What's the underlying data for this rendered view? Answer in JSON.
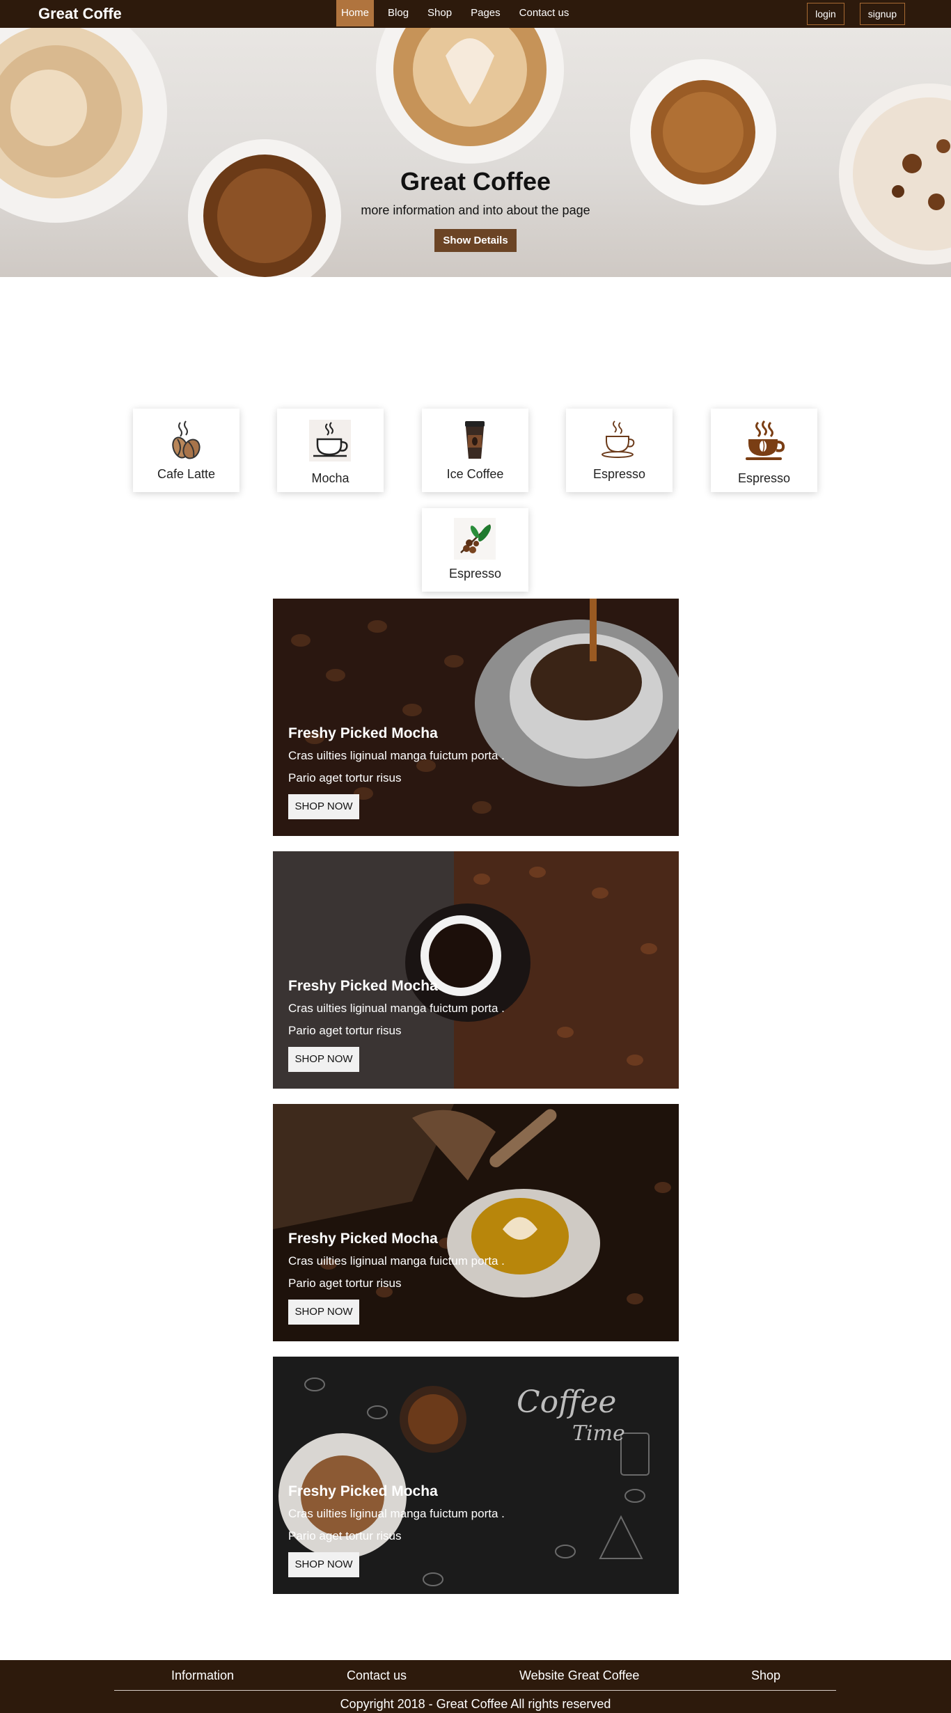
{
  "navbar": {
    "brand": "Great Coffe",
    "links": [
      "Home",
      "Blog",
      "Shop",
      "Pages",
      "Contact us"
    ],
    "active_link": "Home",
    "login": "login",
    "signup": "signup",
    "bg_color": "#2d1a0c",
    "accent_color": "#b0743e"
  },
  "hero": {
    "title": "Great Coffee",
    "subtitle": "more information and into about the page",
    "button": "Show Details"
  },
  "categories": [
    {
      "label": "Cafe Latte",
      "icon": "coffee-beans-icon"
    },
    {
      "label": "Mocha",
      "icon": "coffee-cup-icon"
    },
    {
      "label": "Ice Coffee",
      "icon": "takeaway-cup-icon"
    },
    {
      "label": "Espresso",
      "icon": "espresso-cup-icon"
    },
    {
      "label": "Espresso",
      "icon": "hot-coffee-icon"
    },
    {
      "label": "Espresso",
      "icon": "coffee-branch-icon"
    }
  ],
  "promos": [
    {
      "title": "Freshy Picked Mocha",
      "line1": "Cras uilties liginual manga fuictum porta .",
      "line2": "Pario aget tortur risus",
      "button": "SHOP NOW"
    },
    {
      "title": "Freshy Picked Mocha",
      "line1": "Cras uilties liginual manga fuictum porta .",
      "line2": "Pario aget tortur risus",
      "button": "SHOP NOW"
    },
    {
      "title": "Freshy Picked Mocha",
      "line1": "Cras uilties liginual manga fuictum porta .",
      "line2": "Pario aget tortur risus",
      "button": "SHOP NOW"
    },
    {
      "title": "Freshy Picked Mocha",
      "line1": "Cras uilties liginual manga fuictum porta .",
      "line2": "Pario aget tortur risus",
      "button": "SHOP NOW"
    }
  ],
  "footer": {
    "links": [
      "Information",
      "Contact us",
      "Website Great Coffee",
      "Shop"
    ],
    "copyright": "Copyright 2018 - Great Coffee All rights reserved"
  }
}
